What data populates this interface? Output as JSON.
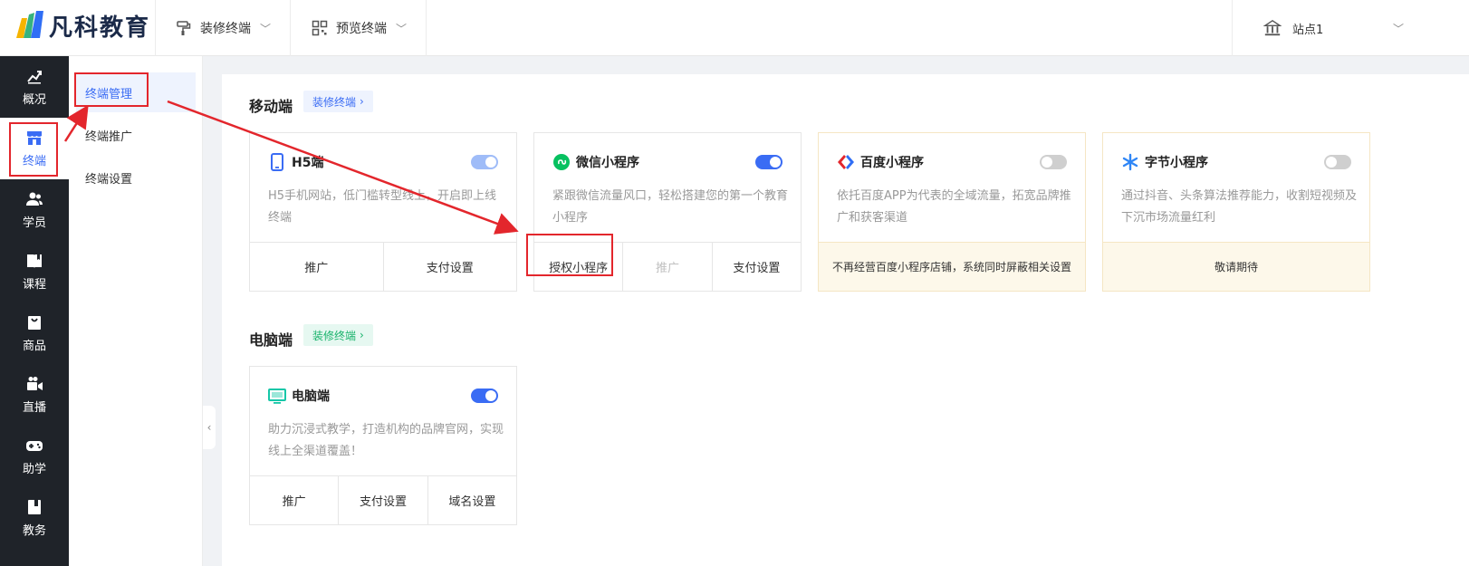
{
  "brand": {
    "name": "凡科教育"
  },
  "topbar": {
    "decorate_label": "装修终端",
    "preview_label": "预览终端",
    "site_label": "站点1"
  },
  "sidebar": {
    "items": [
      {
        "label": "概况",
        "icon": "chart-icon"
      },
      {
        "label": "终端",
        "icon": "store-icon",
        "active": true
      },
      {
        "label": "学员",
        "icon": "users-icon"
      },
      {
        "label": "课程",
        "icon": "book-icon"
      },
      {
        "label": "商品",
        "icon": "bag-icon"
      },
      {
        "label": "直播",
        "icon": "camera-icon"
      },
      {
        "label": "助学",
        "icon": "gamepad-icon"
      },
      {
        "label": "教务",
        "icon": "folder-icon"
      }
    ]
  },
  "subnav": {
    "items": [
      {
        "label": "终端管理",
        "active": true
      },
      {
        "label": "终端推广"
      },
      {
        "label": "终端设置"
      }
    ]
  },
  "mobile": {
    "title": "移动端",
    "tag": "装修终端",
    "cards": [
      {
        "title": "H5端",
        "desc": "H5手机网站，低门槛转型线上，开启即上线终端",
        "toggle": "on-light",
        "buttons": [
          "推广",
          "支付设置"
        ]
      },
      {
        "title": "微信小程序",
        "desc": "紧跟微信流量风口，轻松搭建您的第一个教育小程序",
        "toggle": "on",
        "buttons": [
          "授权小程序",
          "推广",
          "支付设置"
        ]
      },
      {
        "title": "百度小程序",
        "desc": "依托百度APP为代表的全域流量，拓宽品牌推广和获客渠道",
        "toggle": "off",
        "note": "不再经营百度小程序店铺，系统同时屏蔽相关设置"
      },
      {
        "title": "字节小程序",
        "desc": "通过抖音、头条算法推荐能力，收割短视频及下沉市场流量红利",
        "toggle": "off",
        "note": "敬请期待"
      }
    ]
  },
  "pc": {
    "title": "电脑端",
    "tag": "装修终端",
    "cards": [
      {
        "title": "电脑端",
        "desc": "助力沉浸式教学，打造机构的品牌官网，实现线上全渠道覆盖！",
        "toggle": "on",
        "buttons": [
          "推广",
          "支付设置",
          "域名设置"
        ]
      }
    ]
  },
  "colors": {
    "accent": "#3a6cf4",
    "sidebar_bg": "#1f2329",
    "highlight": "#e3262c",
    "tag_green": "#17b26a"
  }
}
